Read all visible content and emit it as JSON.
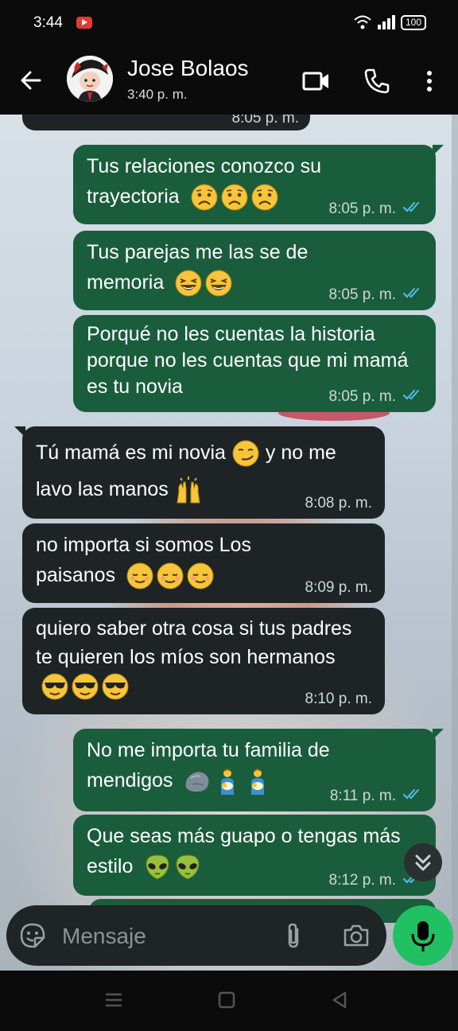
{
  "status_bar": {
    "time": "3:44",
    "battery": "100"
  },
  "header": {
    "contact_name": "Jose Bolaos",
    "contact_status": "3:40 p. m."
  },
  "messages": [
    {
      "direction": "in",
      "text": "",
      "time": "8:05 p. m.",
      "partial": true
    },
    {
      "direction": "out",
      "text": "Tus relaciones conozco su trayectoria",
      "emojis": [
        "frowning-face-emoji",
        "frowning-face-emoji",
        "frowning-face-emoji"
      ],
      "time": "8:05 p. m.",
      "read": true
    },
    {
      "direction": "out",
      "text": "Tus parejas me las se de memoria",
      "emojis": [
        "laughing-face-emoji",
        "laughing-face-emoji"
      ],
      "time": "8:05 p. m.",
      "read": true
    },
    {
      "direction": "out",
      "text": "Porqué no les cuentas la historia porque no les cuentas que mi mamá es tu novia",
      "emojis": [],
      "time": "8:05 p. m.",
      "read": true
    },
    {
      "direction": "in",
      "text_a": "Tú mamá es mi novia",
      "text_b": "y no me lavo las manos",
      "emojis": [
        "smirking-face-emoji",
        "raising-hands-emoji"
      ],
      "time": "8:08 p. m."
    },
    {
      "direction": "in",
      "text": "no importa si somos Los paisanos",
      "emojis": [
        "relieved-face-emoji",
        "relieved-face-emoji",
        "relieved-face-emoji"
      ],
      "time": "8:09 p. m."
    },
    {
      "direction": "in",
      "text": "quiero saber otra cosa si tus padres te quieren los míos son hermanos",
      "emojis": [
        "sunglasses-face-emoji",
        "sunglasses-face-emoji",
        "sunglasses-face-emoji"
      ],
      "time": "8:10 p. m."
    },
    {
      "direction": "out",
      "text": "No me importa tu familia de mendigos",
      "emojis": [
        "rock-emoji",
        "person-feeding-baby-emoji",
        "person-feeding-baby-emoji"
      ],
      "time": "8:11 p. m.",
      "read": true
    },
    {
      "direction": "out",
      "text": "Que seas más guapo o tengas más estilo",
      "emojis": [
        "alien-emoji",
        "alien-emoji"
      ],
      "time": "8:12 p. m.",
      "read": true
    }
  ],
  "composer": {
    "placeholder": "Mensaje"
  },
  "colors": {
    "outgoing_bubble": "#1a5d3c",
    "incoming_bubble": "#1e2426",
    "mic_button": "#21c063",
    "read_ticks": "#53bdeb"
  }
}
